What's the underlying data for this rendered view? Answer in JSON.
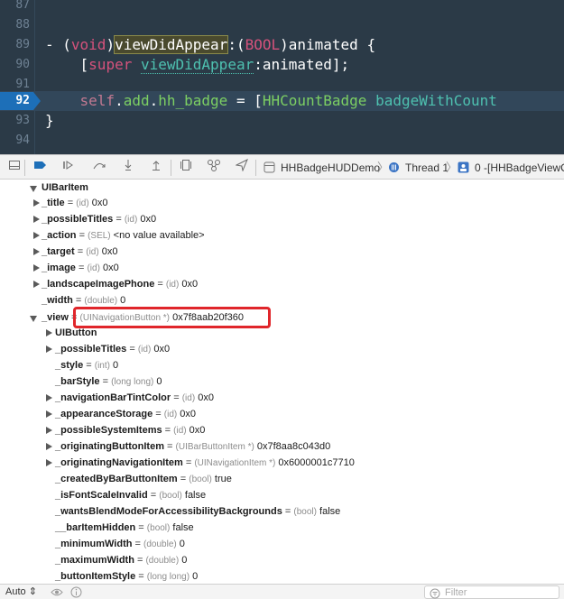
{
  "editor": {
    "lines": [
      {
        "num": "87"
      },
      {
        "num": "88"
      },
      {
        "num": "89",
        "p1": "- (",
        "p2": "void",
        "p3": ")",
        "p4": "viewDidAppear",
        "p5": ":(",
        "p6": "BOOL",
        "p7": ")animated {"
      },
      {
        "num": "90",
        "p1": "    [",
        "p2": "super",
        "p3": " ",
        "p4": "viewDidAppear",
        "p5": ":animated];"
      },
      {
        "num": "91"
      },
      {
        "num": "92",
        "p1": "    ",
        "p2": "self",
        "p3": ".",
        "p4": "add",
        "p5": ".",
        "p6": "hh_badge",
        "p7": " = [",
        "p8": "HHCountBadge",
        "p9": " ",
        "p10": "badgeWithCount"
      },
      {
        "num": "93",
        "p1": "}"
      },
      {
        "num": "94"
      }
    ]
  },
  "toolbar": {
    "crumbs": [
      "HHBadgeHUDDemo",
      "Thread 1",
      "0 -[HHBadgeViewC"
    ]
  },
  "variables": [
    {
      "name": "UIBarItem",
      "eq": "",
      "type": "",
      "value": ""
    },
    {
      "name": "_title",
      "eq": " = ",
      "type": "(id)",
      "value": " 0x0"
    },
    {
      "name": "_possibleTitles",
      "eq": " = ",
      "type": "(id)",
      "value": " 0x0"
    },
    {
      "name": "_action",
      "eq": " = ",
      "type": "(SEL)",
      "value": " <no value available>"
    },
    {
      "name": "_target",
      "eq": " = ",
      "type": "(id)",
      "value": " 0x0"
    },
    {
      "name": "_image",
      "eq": " = ",
      "type": "(id)",
      "value": " 0x0"
    },
    {
      "name": "_landscapeImagePhone",
      "eq": " = ",
      "type": "(id)",
      "value": " 0x0"
    },
    {
      "name": "_width",
      "eq": " = ",
      "type": "(double)",
      "value": " 0"
    },
    {
      "name": "_view",
      "eq": " = ",
      "type": "(UINavigationButton *)",
      "value": " 0x7f8aab20f360"
    },
    {
      "name": "UIButton",
      "eq": "",
      "type": "",
      "value": ""
    },
    {
      "name": "_possibleTitles",
      "eq": " = ",
      "type": "(id)",
      "value": " 0x0"
    },
    {
      "name": "_style",
      "eq": " = ",
      "type": "(int)",
      "value": " 0"
    },
    {
      "name": "_barStyle",
      "eq": " = ",
      "type": "(long long)",
      "value": " 0"
    },
    {
      "name": "_navigationBarTintColor",
      "eq": " = ",
      "type": "(id)",
      "value": " 0x0"
    },
    {
      "name": "_appearanceStorage",
      "eq": " = ",
      "type": "(id)",
      "value": " 0x0"
    },
    {
      "name": "_possibleSystemItems",
      "eq": " = ",
      "type": "(id)",
      "value": " 0x0"
    },
    {
      "name": "_originatingButtonItem",
      "eq": " = ",
      "type": "(UIBarButtonItem *)",
      "value": " 0x7f8aa8c043d0"
    },
    {
      "name": "_originatingNavigationItem",
      "eq": " = ",
      "type": "(UINavigationItem *)",
      "value": " 0x6000001c7710"
    },
    {
      "name": "_createdByBarButtonItem",
      "eq": " = ",
      "type": "(bool)",
      "value": " true"
    },
    {
      "name": "_isFontScaleInvalid",
      "eq": " = ",
      "type": "(bool)",
      "value": " false"
    },
    {
      "name": "_wantsBlendModeForAccessibilityBackgrounds",
      "eq": " = ",
      "type": "(bool)",
      "value": " false"
    },
    {
      "name": "__barItemHidden",
      "eq": " = ",
      "type": "(bool)",
      "value": " false"
    },
    {
      "name": "_minimumWidth",
      "eq": " = ",
      "type": "(double)",
      "value": " 0"
    },
    {
      "name": "_maximumWidth",
      "eq": " = ",
      "type": "(double)",
      "value": " 0"
    },
    {
      "name": "_buttonItemStyle",
      "eq": " = ",
      "type": "(long long)",
      "value": " 0"
    }
  ],
  "bottombar": {
    "scope_label": "Auto",
    "filter_placeholder": "Filter"
  },
  "colors": {
    "highlight": "#e0262b",
    "current_line": "#1d6fb8",
    "editor_bg": "#2b3a47"
  }
}
